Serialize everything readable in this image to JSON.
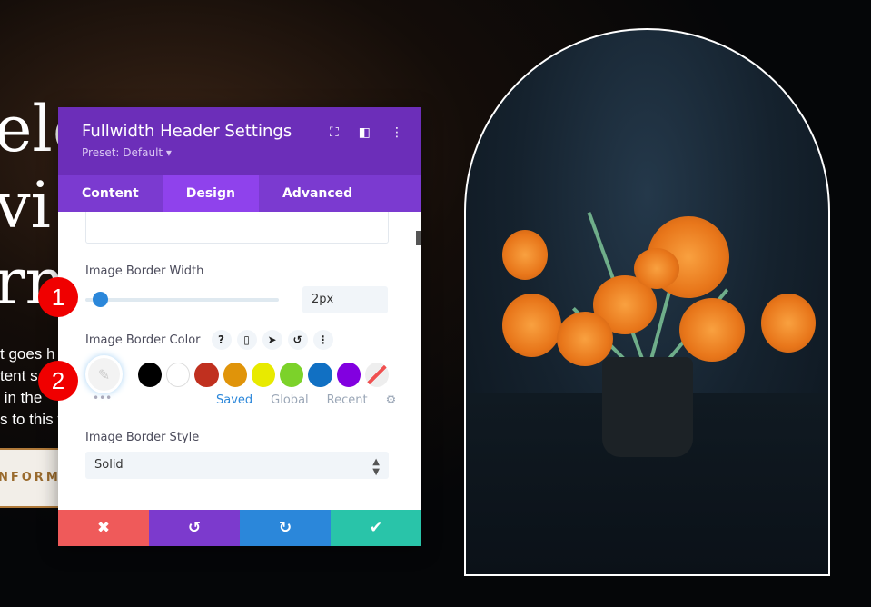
{
  "hero": {
    "title": "elc\nvi\nrn",
    "body": "t goes h\ntent s\n in the \ns to this t",
    "button": "NFORMA"
  },
  "panel": {
    "title": "Fullwidth Header Settings",
    "preset": "Preset: Default ▾",
    "header_icons": [
      "fullscreen-icon",
      "sidebar-toggle-icon",
      "more-vertical-icon"
    ],
    "tabs": [
      {
        "label": "Content"
      },
      {
        "label": "Design",
        "active": true
      },
      {
        "label": "Advanced"
      }
    ],
    "border_width": {
      "label": "Image Border Width",
      "value": "2px",
      "slider_percent": 2
    },
    "border_color": {
      "label": "Image Border Color",
      "icons": [
        "?",
        "▯",
        "➤",
        "↺",
        "⋮"
      ],
      "swatches": [
        "#000000",
        "#ffffff",
        "#c0301f",
        "#e0940a",
        "#e8ea00",
        "#7cd22a",
        "#1170c3",
        "#8200e0"
      ],
      "more": "•••",
      "color_tabs": [
        "Saved",
        "Global",
        "Recent"
      ]
    },
    "border_style": {
      "label": "Image Border Style",
      "value": "Solid"
    },
    "footer": {
      "cancel": "✖",
      "undo": "↺",
      "redo": "↻",
      "save": "✔"
    },
    "colors": {
      "header": "#6c2eb9",
      "tabs": "#7b3ad0",
      "cancel": "#ef5a5a",
      "undo": "#7c3acd",
      "redo": "#2b87da",
      "save": "#29c4a9"
    }
  },
  "badges": [
    "1",
    "2"
  ]
}
